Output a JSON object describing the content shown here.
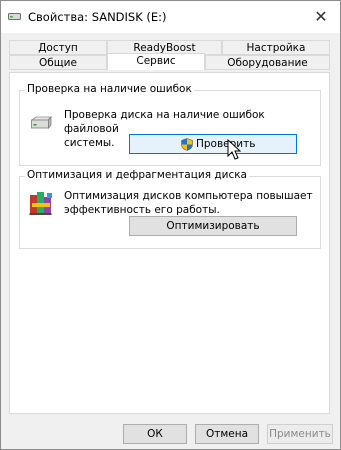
{
  "window": {
    "title": "Свойства: SANDISK (E:)",
    "close_glyph": "✕"
  },
  "tabs": {
    "row1": [
      {
        "label": "Доступ"
      },
      {
        "label": "ReadyBoost"
      },
      {
        "label": "Настройка"
      }
    ],
    "row2": [
      {
        "label": "Общие"
      },
      {
        "label": "Сервис",
        "active": true
      },
      {
        "label": "Оборудование"
      }
    ]
  },
  "error_check": {
    "title": "Проверка на наличие ошибок",
    "description_line1": "Проверка диска на наличие ошибок файловой",
    "description_line2": "системы.",
    "button_label": "Проверить",
    "icon": "drive-icon",
    "button_icon": "uac-shield-icon"
  },
  "optimize": {
    "title": "Оптимизация и дефрагментация диска",
    "description_line1": "Оптимизация дисков компьютера повышает",
    "description_line2": "эффективность его работы.",
    "button_label": "Оптимизировать",
    "icon": "defrag-icon"
  },
  "footer": {
    "ok_label": "ОК",
    "cancel_label": "Отмена",
    "apply_label": "Применить"
  },
  "colors": {
    "accent": "#0078d7",
    "panel_bg": "#ffffff",
    "window_bg": "#f0f0f0"
  }
}
